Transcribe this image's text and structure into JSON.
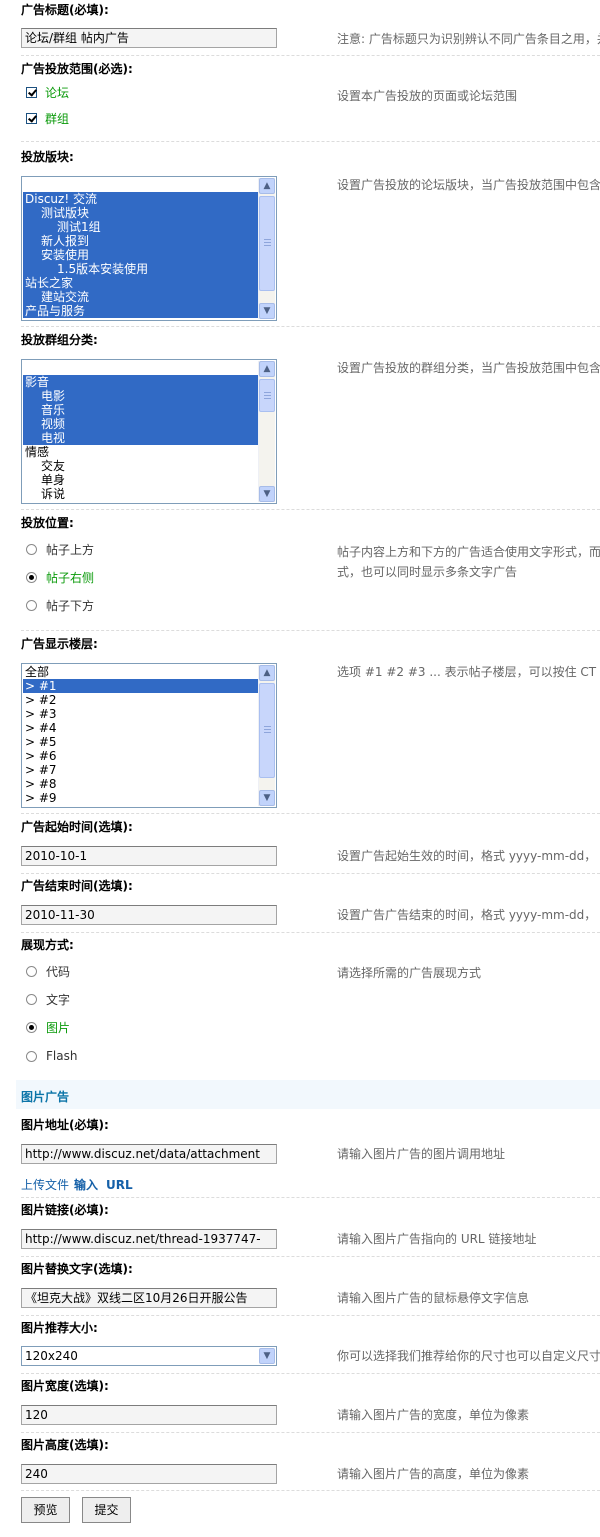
{
  "form": {
    "ad_title": {
      "label": "广告标题(必填):",
      "value": "论坛/群组 帖内广告",
      "tip": "注意: 广告标题只为识别辨认不同广告条目之用，并"
    },
    "scope": {
      "label": "广告投放范围(必选):",
      "options": [
        "论坛",
        "群组"
      ],
      "tip": "设置本广告投放的页面或论坛范围"
    },
    "forums": {
      "label": "投放版块:",
      "items": [
        "",
        "Discuz! 交流",
        "测试版块",
        "测试1组",
        "新人报到",
        "安装使用",
        "1.5版本安装使用",
        "站长之家",
        "建站交流",
        "产品与服务"
      ],
      "tip": "设置广告投放的论坛版块，当广告投放范围中包含"
    },
    "groups": {
      "label": "投放群组分类:",
      "items": [
        "",
        "影音",
        "电影",
        "音乐",
        "视频",
        "电视",
        "情感",
        "交友",
        "单身",
        "诉说"
      ],
      "tip": "设置广告投放的群组分类，当广告投放范围中包含"
    },
    "position": {
      "label": "投放位置:",
      "options": [
        "帖子上方",
        "帖子右侧",
        "帖子下方"
      ],
      "selected": "帖子右侧",
      "tip_line1": "帖子内容上方和下方的广告适合使用文字形式，而",
      "tip_line2": "式，也可以同时显示多条文字广告"
    },
    "floors": {
      "label": "广告显示楼层:",
      "items": [
        "全部",
        "> #1",
        "> #2",
        "> #3",
        "> #4",
        "> #5",
        "> #6",
        "> #7",
        "> #8",
        "> #9"
      ],
      "tip": "选项 #1 #2 #3 ... 表示帖子楼层，可以按住 CT"
    },
    "start_time": {
      "label": "广告起始时间(选填):",
      "value": "2010-10-1",
      "tip": "设置广告起始生效的时间，格式 yyyy-mm-dd，"
    },
    "end_time": {
      "label": "广告结束时间(选填):",
      "value": "2010-11-30",
      "tip": "设置广告广告结束的时间，格式 yyyy-mm-dd，"
    },
    "display": {
      "label": "展现方式:",
      "options": [
        "代码",
        "文字",
        "图片",
        "Flash"
      ],
      "selected": "图片",
      "tip": "请选择所需的广告展现方式"
    }
  },
  "image_ad": {
    "section_title": "图片广告",
    "url": {
      "label": "图片地址(必填):",
      "value": "http://www.discuz.net/data/attachment",
      "tip": "请输入图片广告的图片调用地址"
    },
    "upload_links": [
      "上传文件",
      "输入",
      "URL"
    ],
    "link": {
      "label": "图片链接(必填):",
      "value": "http://www.discuz.net/thread-1937747-",
      "tip": "请输入图片广告指向的 URL 链接地址"
    },
    "alt": {
      "label": "图片替换文字(选填):",
      "value": "《坦克大战》双线二区10月26日开服公告",
      "tip": "请输入图片广告的鼠标悬停文字信息"
    },
    "size": {
      "label": "图片推荐大小:",
      "value": "120x240",
      "tip": "你可以选择我们推荐给你的尺寸也可以自定义尺寸"
    },
    "width": {
      "label": "图片宽度(选填):",
      "value": "120",
      "tip": "请输入图片广告的宽度，单位为像素"
    },
    "height": {
      "label": "图片高度(选填):",
      "value": "240",
      "tip": "请输入图片广告的高度，单位为像素"
    }
  },
  "buttons": {
    "preview": "预览",
    "submit": "提交"
  },
  "icons": {
    "scroll_up": "▲",
    "scroll_down": "▼"
  },
  "colors": {
    "selection": "#316ac5",
    "option_green": "#0a9a0a",
    "section_title": "#0b74a8",
    "link": "#1560a8"
  }
}
